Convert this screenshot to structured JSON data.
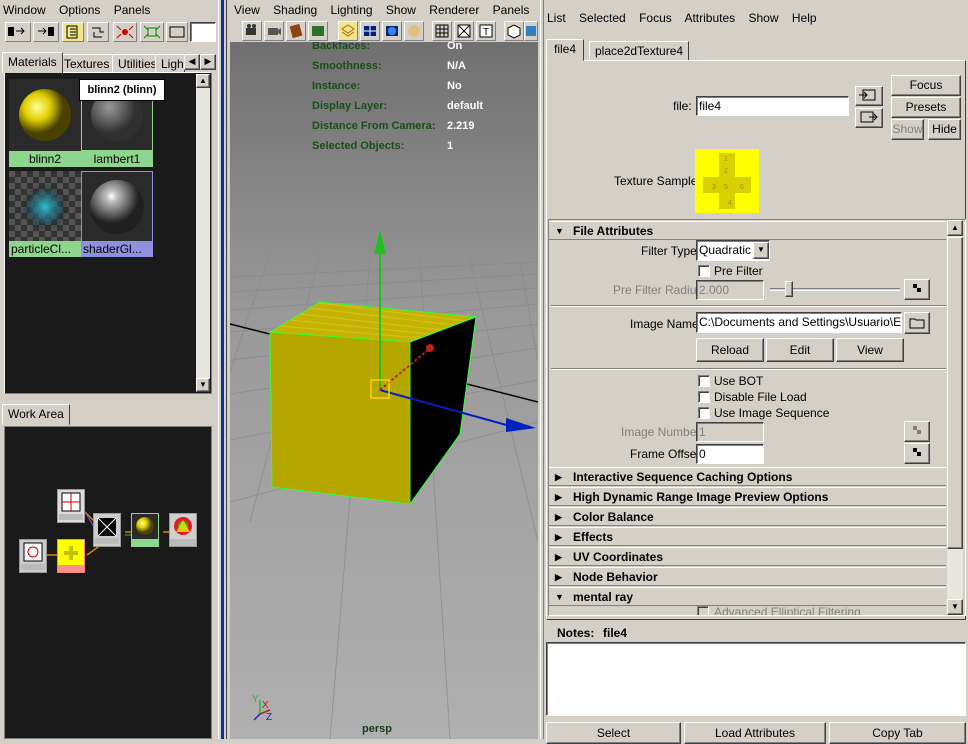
{
  "left_menu": [
    "Window",
    "Options",
    "Panels"
  ],
  "hypershade_tabs": [
    "Materials",
    "Textures",
    "Utilities",
    "Ligh"
  ],
  "materials": [
    {
      "label": "blinn2",
      "tooltip": "blinn2 (blinn)"
    },
    {
      "label": "lambert1"
    },
    {
      "label": "particleCl..."
    },
    {
      "label": "shaderGl..."
    }
  ],
  "work_area_title": "Work Area",
  "viewport_menu": [
    "View",
    "Shading",
    "Lighting",
    "Show",
    "Renderer",
    "Panels"
  ],
  "hud": [
    {
      "label": "Backfaces:",
      "value": "On"
    },
    {
      "label": "Smoothness:",
      "value": "N/A"
    },
    {
      "label": "Instance:",
      "value": "No"
    },
    {
      "label": "Display Layer:",
      "value": "default"
    },
    {
      "label": "Distance From Camera:",
      "value": "2.219"
    },
    {
      "label": "Selected Objects:",
      "value": "1"
    }
  ],
  "camera_label": "persp",
  "axis_labels": {
    "y": "Y",
    "x": "X",
    "z": "Z"
  },
  "ae_menu": [
    "List",
    "Selected",
    "Focus",
    "Attributes",
    "Show",
    "Help"
  ],
  "ae_tabs": [
    "file4",
    "place2dTexture4"
  ],
  "file_label": "file:",
  "file_value": "file4",
  "ae_buttons": {
    "focus": "Focus",
    "presets": "Presets",
    "show": "Show",
    "hide": "Hide"
  },
  "texture_sample_label": "Texture Sample",
  "texture_sample_numbers": [
    "1",
    "2",
    "3",
    "4",
    "5",
    "6"
  ],
  "file_attributes": {
    "title": "File Attributes",
    "filter_type_label": "Filter Type",
    "filter_type_value": "Quadratic",
    "pre_filter": "Pre Filter",
    "pre_filter_radius_label": "Pre Filter Radius",
    "pre_filter_radius_value": "2.000",
    "pre_filter_radius_slider": 0.12,
    "image_name_label": "Image Name",
    "image_name_value": "C:\\Documents and Settings\\Usuario\\Escri",
    "reload": "Reload",
    "edit": "Edit",
    "view": "View",
    "use_bot": "Use BOT",
    "disable_file_load": "Disable File Load",
    "use_image_sequence": "Use Image Sequence",
    "image_number_label": "Image Number",
    "image_number_value": "1",
    "frame_offset_label": "Frame Offset",
    "frame_offset_value": "0"
  },
  "sections": [
    "Interactive Sequence Caching Options",
    "High Dynamic Range Image Preview Options",
    "Color Balance",
    "Effects",
    "UV Coordinates",
    "Node Behavior",
    "mental ray"
  ],
  "mental_ray_first": "Advanced Elliptical Filtering",
  "notes_label": "Notes:",
  "notes_name": "file4",
  "bottom_buttons": [
    "Select",
    "Load Attributes",
    "Copy Tab"
  ],
  "colors": {
    "viewport_top": "#707070",
    "viewport_bottom": "#b0b0b0",
    "cube": "#b5a600",
    "highlight": "#33ff33",
    "hud_label": "#1a4d1a",
    "swatch_green": "#8ed68e",
    "swatch_blue": "#9090e0"
  }
}
